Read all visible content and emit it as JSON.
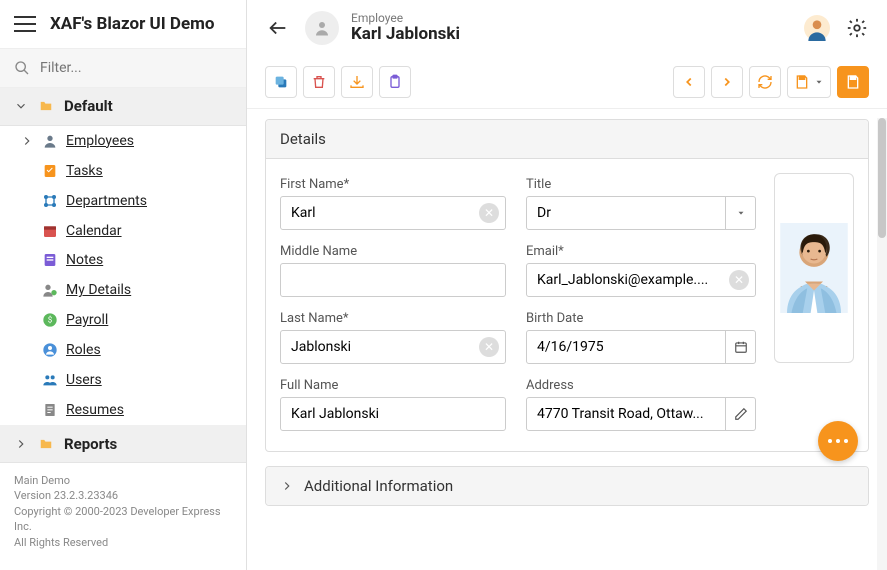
{
  "app": {
    "title": "XAF's Blazor UI Demo"
  },
  "filter": {
    "placeholder": "Filter..."
  },
  "nav": {
    "groups": [
      {
        "label": "Default",
        "expanded": true
      },
      {
        "label": "Reports",
        "expanded": false
      }
    ],
    "items": [
      {
        "label": "Employees",
        "icon": "person-icon",
        "active": true
      },
      {
        "label": "Tasks",
        "icon": "task-icon"
      },
      {
        "label": "Departments",
        "icon": "dept-icon"
      },
      {
        "label": "Calendar",
        "icon": "calendar-icon"
      },
      {
        "label": "Notes",
        "icon": "notes-icon"
      },
      {
        "label": "My Details",
        "icon": "mydetails-icon"
      },
      {
        "label": "Payroll",
        "icon": "payroll-icon"
      },
      {
        "label": "Roles",
        "icon": "roles-icon"
      },
      {
        "label": "Users",
        "icon": "users-icon"
      },
      {
        "label": "Resumes",
        "icon": "resumes-icon"
      }
    ]
  },
  "footer": {
    "l1": "Main Demo",
    "l2": "Version 23.2.3.23346",
    "l3": "Copyright © 2000-2023 Developer Express Inc.",
    "l4": "All Rights Reserved"
  },
  "header": {
    "entityType": "Employee",
    "entityName": "Karl Jablonski"
  },
  "details": {
    "panelTitle": "Details",
    "firstName": {
      "label": "First Name*",
      "value": "Karl"
    },
    "middleName": {
      "label": "Middle Name",
      "value": ""
    },
    "lastName": {
      "label": "Last Name*",
      "value": "Jablonski"
    },
    "fullName": {
      "label": "Full Name",
      "value": "Karl Jablonski"
    },
    "title": {
      "label": "Title",
      "value": "Dr"
    },
    "email": {
      "label": "Email*",
      "value": "Karl_Jablonski@example...."
    },
    "birthDate": {
      "label": "Birth Date",
      "value": "4/16/1975"
    },
    "address": {
      "label": "Address",
      "value": "4770 Transit Road, Ottaw..."
    }
  },
  "additional": {
    "title": "Additional Information"
  },
  "colors": {
    "accent": "#f7941d"
  }
}
